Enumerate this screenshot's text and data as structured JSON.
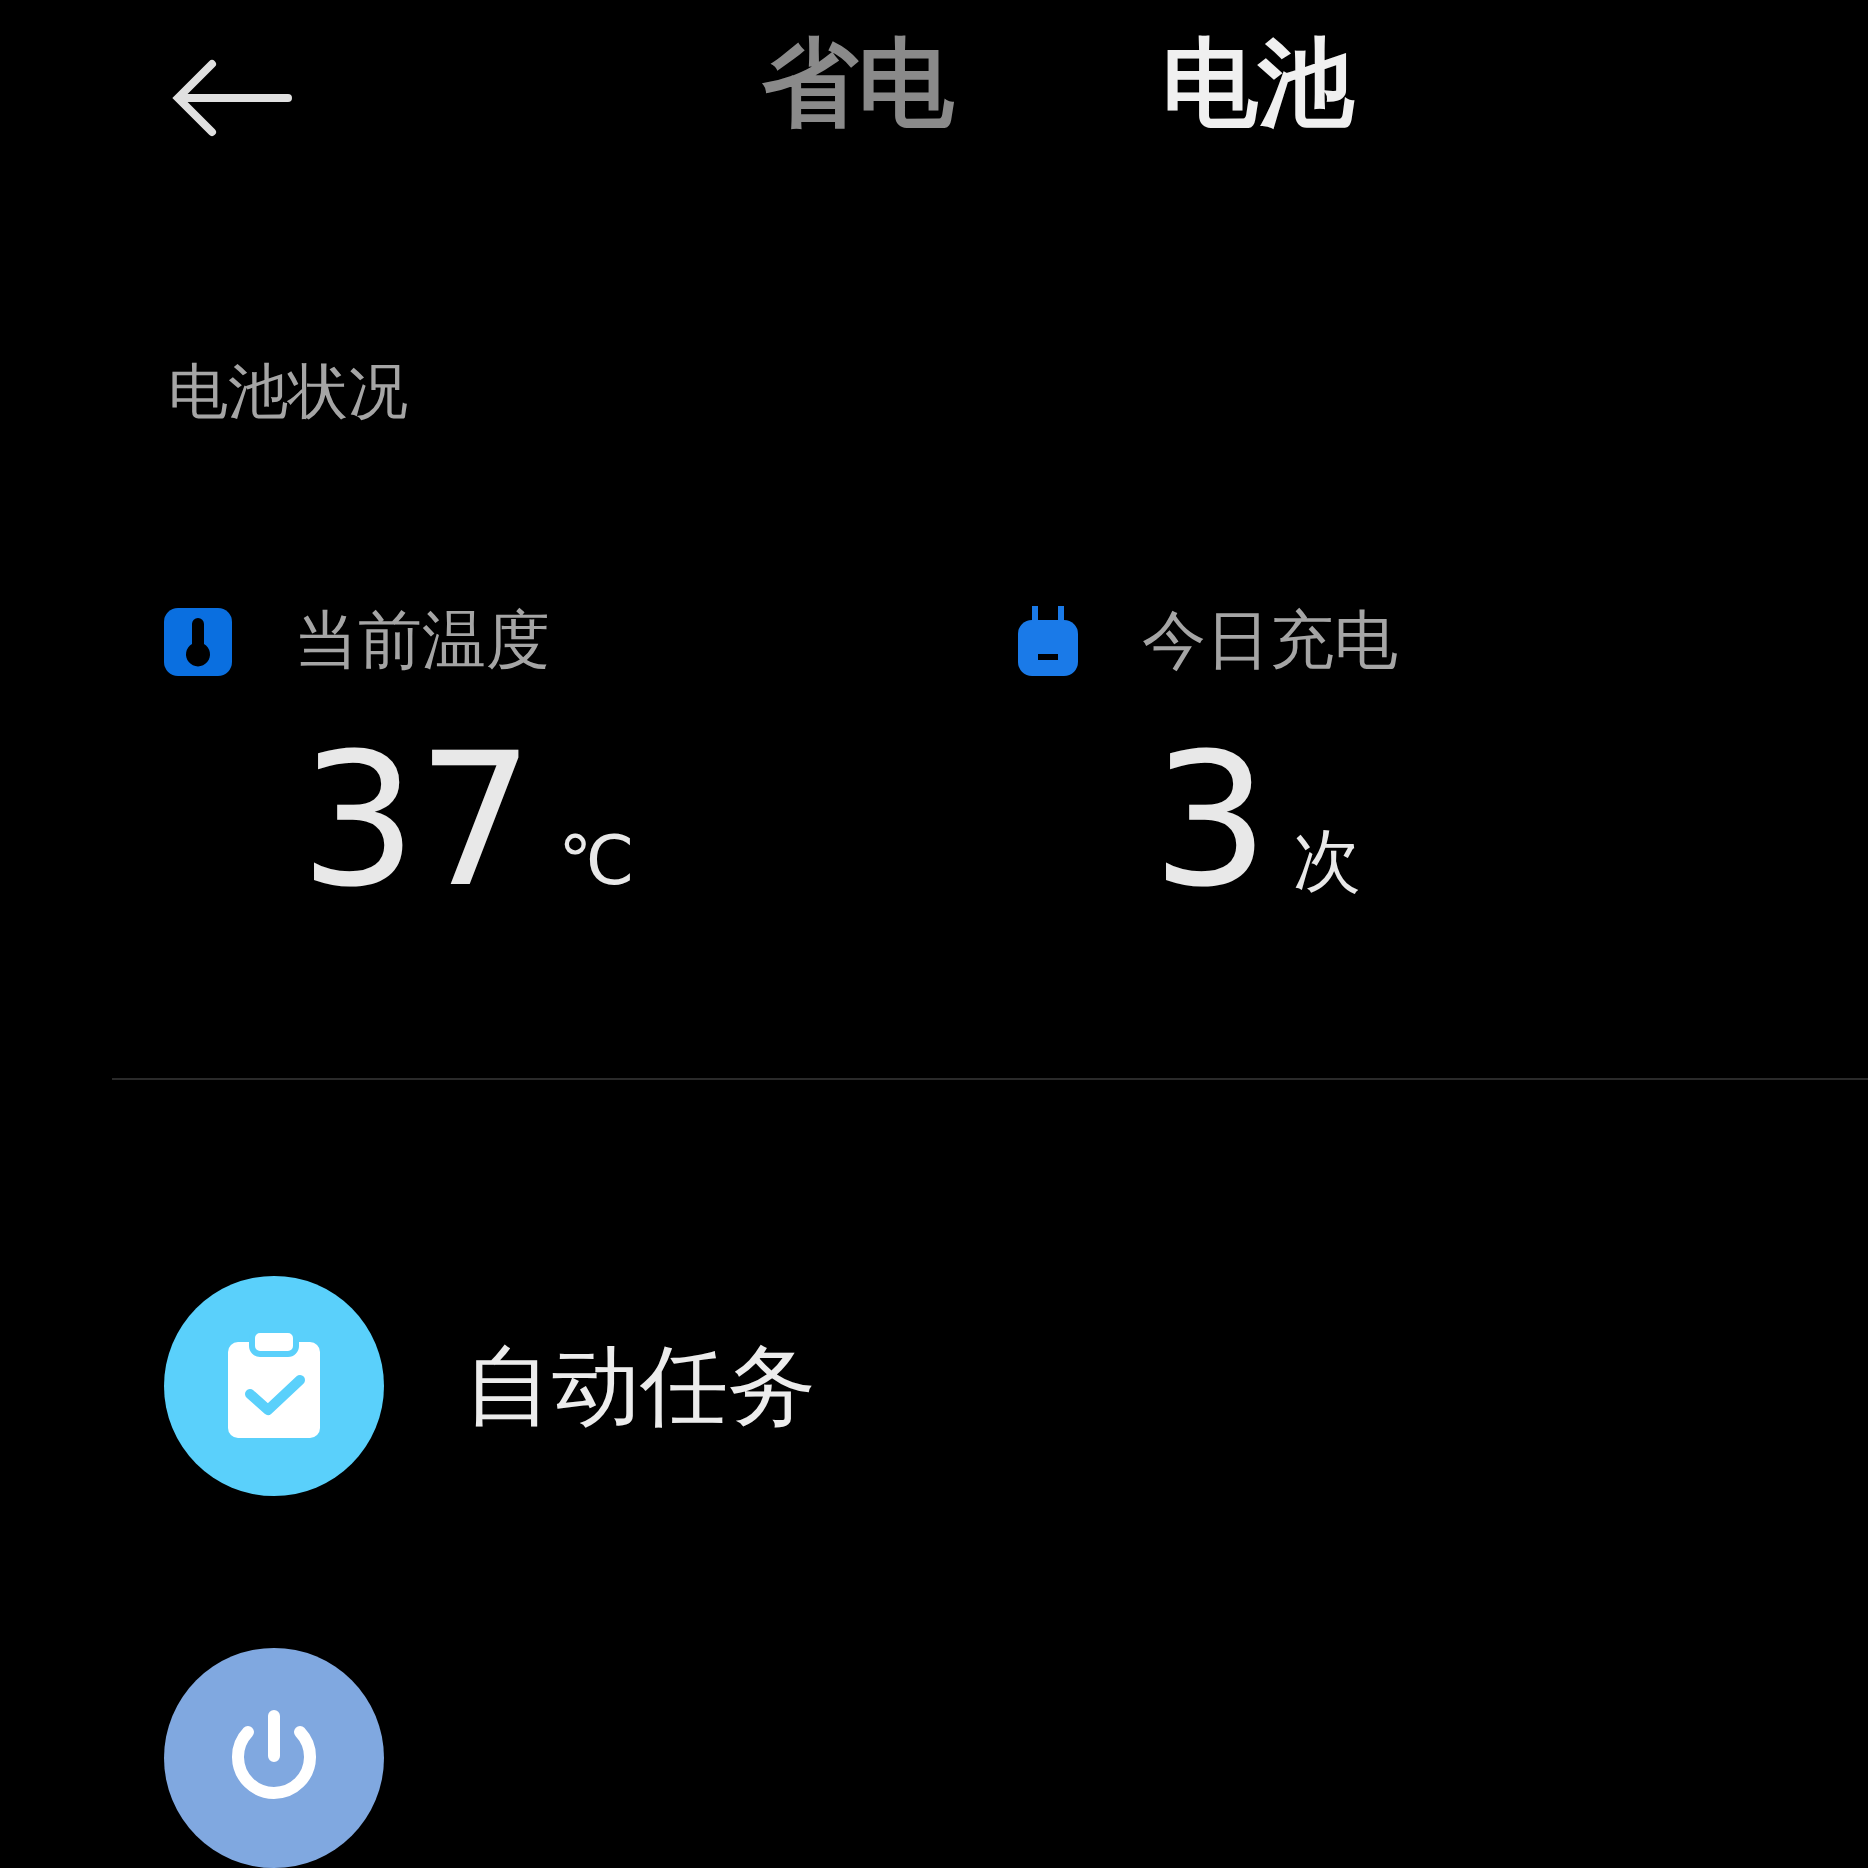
{
  "header": {
    "tabs": [
      {
        "label": "省电",
        "selected": false
      },
      {
        "label": "电池",
        "selected": true
      }
    ]
  },
  "section_title": "电池状况",
  "stats": [
    {
      "kind": "temperature",
      "label": "当前温度",
      "value": "37",
      "unit": "℃"
    },
    {
      "kind": "charge",
      "label": "今日充电",
      "value": "3",
      "unit": "次"
    }
  ],
  "list": [
    {
      "kind": "tasks",
      "label": "自动任务"
    },
    {
      "kind": "power"
    }
  ]
}
